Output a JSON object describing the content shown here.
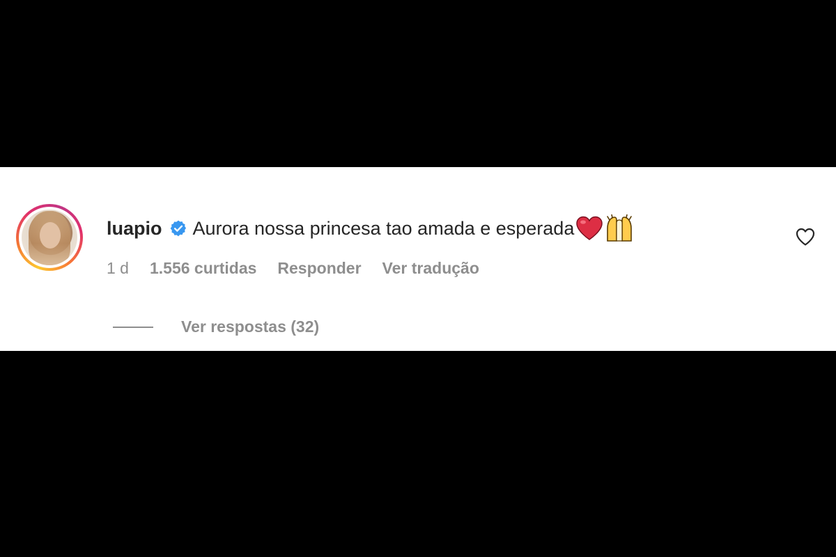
{
  "comment": {
    "username": "luapio",
    "text": "Aurora nossa princesa tao amada e esperada",
    "emojis": [
      "red-heart",
      "raising-hands"
    ],
    "time": "1 d",
    "likes": "1.556 curtidas",
    "reply_label": "Responder",
    "translate_label": "Ver tradução",
    "view_replies_label": "Ver respostas (32)"
  },
  "icons": {
    "verified": "verified-badge-icon",
    "like": "heart-outline-icon"
  },
  "colors": {
    "verified_blue": "#3897f0",
    "heart_red": "#e0245e",
    "text": "#262626",
    "muted": "#8e8e8e"
  }
}
